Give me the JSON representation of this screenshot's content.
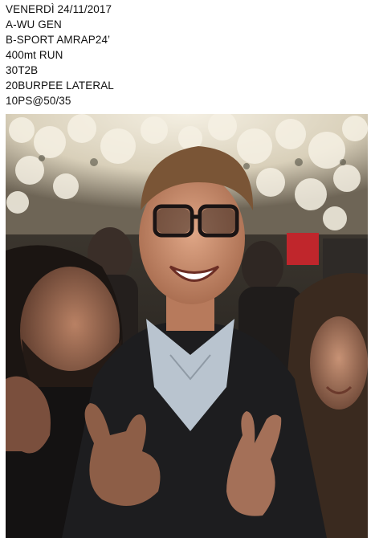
{
  "post": {
    "caption_lines": [
      "VENERDÌ 24/11/2017",
      "A-WU GEN",
      "B-SPORT AMRAP24’",
      "400mt RUN",
      "30T2B",
      "20BURPEE LATERAL",
      "10PS@50/35"
    ],
    "photo": {
      "icon": "photo-image",
      "colors": {
        "ceiling_flowers": "#e9e2cf",
        "background_dark": "#2a2623",
        "skin": "#c98f6f",
        "jacket": "#1d1d1f",
        "shirt": "#b9c4cf",
        "red_sign": "#c0262c"
      }
    }
  }
}
